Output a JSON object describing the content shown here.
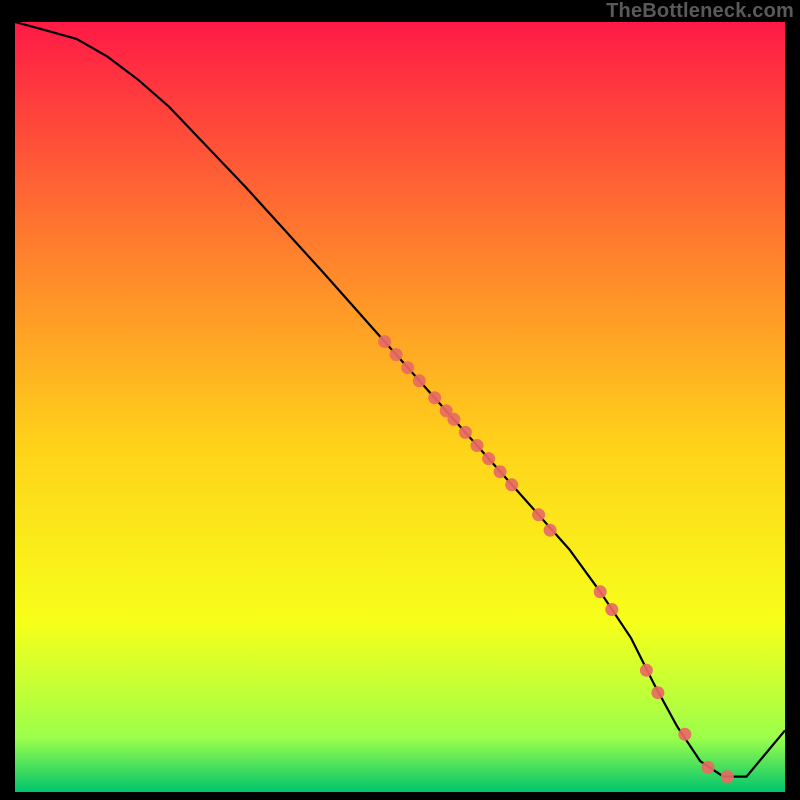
{
  "watermark": "TheBottleneck.com",
  "chart_data": {
    "type": "line",
    "title": "",
    "xlabel": "",
    "ylabel": "",
    "xlim": [
      0,
      100
    ],
    "ylim": [
      0,
      100
    ],
    "background_gradient": {
      "top": "#ff1a46",
      "one_quarter": "#ff7a2e",
      "mid": "#ffd21a",
      "three_quarter": "#f7ff1a",
      "near_bottom": "#9bff4a",
      "bottom": "#00c46e"
    },
    "line": {
      "color": "#000000",
      "x": [
        0,
        3,
        8,
        12,
        16,
        20,
        30,
        40,
        48,
        52,
        56,
        60,
        64,
        68,
        72,
        76,
        80,
        83,
        86,
        89,
        92,
        95,
        100
      ],
      "y": [
        100,
        99.2,
        97.8,
        95.5,
        92.5,
        89.0,
        78.5,
        67.5,
        58.5,
        54.0,
        49.5,
        45.0,
        40.5,
        36.0,
        31.5,
        26.0,
        20.0,
        14.0,
        8.5,
        4.0,
        2.0,
        2.0,
        8.0
      ]
    },
    "markers": {
      "color": "#e96a63",
      "points": [
        {
          "x": 48,
          "y": 58.5
        },
        {
          "x": 49.5,
          "y": 56.8
        },
        {
          "x": 51,
          "y": 55.1
        },
        {
          "x": 52.5,
          "y": 53.4
        },
        {
          "x": 54.5,
          "y": 51.2
        },
        {
          "x": 56,
          "y": 49.5
        },
        {
          "x": 57,
          "y": 48.4
        },
        {
          "x": 58.5,
          "y": 46.7
        },
        {
          "x": 60,
          "y": 45.0
        },
        {
          "x": 61.5,
          "y": 43.3
        },
        {
          "x": 63,
          "y": 41.6
        },
        {
          "x": 64.5,
          "y": 39.9
        },
        {
          "x": 68,
          "y": 36.0
        },
        {
          "x": 69.5,
          "y": 34.0
        },
        {
          "x": 76,
          "y": 26.0
        },
        {
          "x": 77.5,
          "y": 23.7
        },
        {
          "x": 82,
          "y": 15.8
        },
        {
          "x": 83.5,
          "y": 12.9
        },
        {
          "x": 87,
          "y": 7.5
        },
        {
          "x": 90,
          "y": 3.2
        },
        {
          "x": 92.5,
          "y": 2.0
        }
      ]
    }
  }
}
